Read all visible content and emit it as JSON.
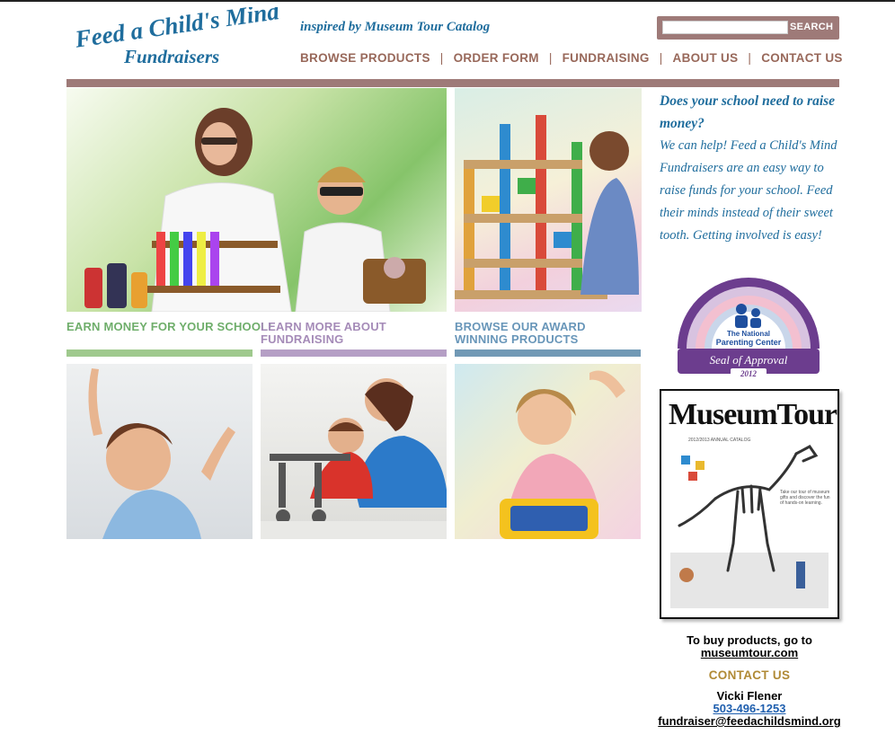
{
  "brand": {
    "logo_line1": "Feed a Child's Mind",
    "logo_line2": "Fundraisers",
    "tagline": "inspired by Museum Tour Catalog"
  },
  "search": {
    "placeholder": "",
    "button_label": "SEARCH"
  },
  "nav": {
    "items": [
      {
        "label": "BROWSE PRODUCTS"
      },
      {
        "label": "ORDER FORM"
      },
      {
        "label": "FUNDRAISING"
      },
      {
        "label": "ABOUT US"
      },
      {
        "label": "CONTACT US"
      }
    ],
    "separator": "|"
  },
  "features": [
    {
      "caption": "EARN MONEY FOR YOUR SCHOOL!",
      "color": "#6fae6b"
    },
    {
      "caption": "LEARN MORE ABOUT FUNDRAISING",
      "color": "#a58bb8"
    },
    {
      "caption": "BROWSE OUR AWARD WINNING PRODUCTS",
      "color": "#6896b9"
    }
  ],
  "sidebar": {
    "heading": "Does your school need to raise money?",
    "body": "We can help! Feed a Child's Mind Fundraisers are an easy way to raise funds for your school. Feed their minds instead of their sweet tooth. Getting involved is easy!",
    "seal": {
      "line1": "The National",
      "line2": "Parenting Center",
      "line3": "Seal of Approval",
      "year": "2012"
    },
    "catalog": {
      "title": "MuseumTour",
      "subtitle": "2012/2013 ANNUAL CATALOG",
      "note": "Take our tour of museum gifts and discover the fun of hands-on learning."
    },
    "buy_text": "To buy products, go to",
    "buy_link": "museumtour.com"
  },
  "contact": {
    "heading": "CONTACT US",
    "name": "Vicki Flener",
    "phone": "503-496-1253",
    "email": "fundraiser@feedachildsmind.org"
  },
  "colors": {
    "accent_blue": "#1f6d9d",
    "nav_brown": "#98685a",
    "divider": "#9e7a78",
    "contact_gold": "#b08a36"
  }
}
